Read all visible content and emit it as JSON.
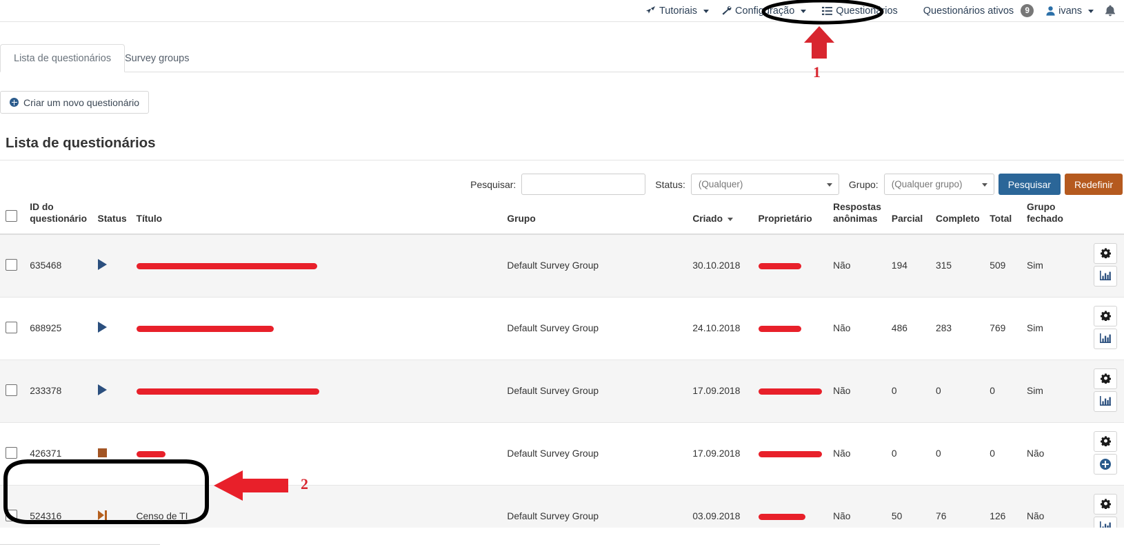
{
  "topnav": {
    "items": [
      {
        "label": "Tutoriais",
        "icon": "rocket-icon",
        "caret": true
      },
      {
        "label": "Configuração",
        "icon": "wrench-icon",
        "caret": true
      },
      {
        "label": "Questionários",
        "icon": "list-icon",
        "caret": false
      },
      {
        "label": "Questionários ativos",
        "icon": "",
        "caret": false,
        "badge": "9"
      },
      {
        "label": "ivans",
        "icon": "user-icon",
        "caret": true
      }
    ],
    "standalone_caret": "▾",
    "bell_icon": "bell-icon"
  },
  "tabs": [
    {
      "label": "Lista de questionários",
      "active": true
    },
    {
      "label": "Survey groups",
      "active": false
    }
  ],
  "create_button": {
    "label": "Criar um novo questionário",
    "icon": "plus-circle-icon"
  },
  "page_title": "Lista de questionários",
  "filters": {
    "search_label": "Pesquisar:",
    "search_value": "",
    "search_placeholder": "",
    "status_label": "Status:",
    "status_value": "(Qualquer)",
    "status_options": [
      "(Qualquer)"
    ],
    "group_label": "Grupo:",
    "group_value": "(Qualquer grupo)",
    "group_options": [
      "(Qualquer grupo)"
    ],
    "search_button": "Pesquisar",
    "reset_button": "Redefinir"
  },
  "table": {
    "headers": {
      "select_all": "",
      "id": "ID do questionário",
      "status": "Status",
      "title": "Título",
      "group": "Grupo",
      "created": "Criado",
      "owner": "Proprietário",
      "anonymous": "Respostas anônimas",
      "partial": "Parcial",
      "complete": "Completo",
      "total": "Total",
      "closed_group": "Grupo fechado"
    },
    "sorted_column": "created",
    "rows": [
      {
        "id": "635468",
        "status_icon": "play-icon",
        "title": "",
        "title_redacted": true,
        "title_redact_width": 262,
        "group": "Default Survey Group",
        "created": "30.10.2018",
        "owner": "",
        "owner_redacted": true,
        "owner_redact_width": 62,
        "anonymous": "Não",
        "partial": "194",
        "complete": "315",
        "total": "509",
        "closed_group": "Sim",
        "actions": [
          "gear-icon",
          "bar-chart-icon"
        ]
      },
      {
        "id": "688925",
        "status_icon": "play-icon",
        "title": "",
        "title_redacted": true,
        "title_redact_width": 199,
        "group": "Default Survey Group",
        "created": "24.10.2018",
        "owner": "",
        "owner_redacted": true,
        "owner_redact_width": 62,
        "anonymous": "Não",
        "partial": "486",
        "complete": "283",
        "total": "769",
        "closed_group": "Sim",
        "actions": [
          "gear-icon",
          "bar-chart-icon"
        ]
      },
      {
        "id": "233378",
        "status_icon": "play-icon",
        "title": "",
        "title_redacted": true,
        "title_redact_width": 265,
        "group": "Default Survey Group",
        "created": "17.09.2018",
        "owner": "",
        "owner_redacted": true,
        "owner_redact_width": 92,
        "anonymous": "Não",
        "partial": "0",
        "complete": "0",
        "total": "0",
        "closed_group": "Sim",
        "actions": [
          "gear-icon",
          "bar-chart-icon"
        ]
      },
      {
        "id": "426371",
        "status_icon": "stop-icon",
        "title": "",
        "title_redacted": true,
        "title_redact_width": 42,
        "group": "Default Survey Group",
        "created": "17.09.2018",
        "owner": "",
        "owner_redacted": true,
        "owner_redact_width": 92,
        "anonymous": "Não",
        "partial": "0",
        "complete": "0",
        "total": "0",
        "closed_group": "Não",
        "actions": [
          "gear-icon",
          "plus-circle-icon"
        ]
      },
      {
        "id": "524316",
        "status_icon": "expired-icon",
        "title": "Censo de TI",
        "title_redacted": false,
        "title_redact_width": 0,
        "group": "Default Survey Group",
        "created": "03.09.2018",
        "owner": "",
        "owner_redacted": true,
        "owner_redact_width": 68,
        "anonymous": "Não",
        "partial": "50",
        "complete": "76",
        "total": "126",
        "closed_group": "Não",
        "actions": [
          "gear-icon",
          "bar-chart-icon"
        ]
      }
    ]
  },
  "annotations": {
    "step1_number": "1",
    "step2_number": "2",
    "highlight_color": "#d8262f",
    "circle_color": "#000000",
    "step1_target": "Questionários",
    "step2_target": "Censo de TI"
  }
}
